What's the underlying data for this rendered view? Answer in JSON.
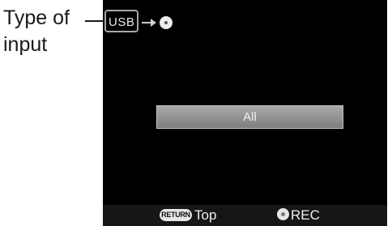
{
  "callout": {
    "line1": "Type of",
    "line2": "input"
  },
  "topbar": {
    "input_type": "USB",
    "separator_icon": "arrow-right-icon",
    "media_icon": "disc-icon"
  },
  "main": {
    "selected_item": "All"
  },
  "footer": {
    "return_key_label": "RETURN",
    "return_action": "Top",
    "rec_icon": "rec-button-icon",
    "rec_action": "REC"
  }
}
